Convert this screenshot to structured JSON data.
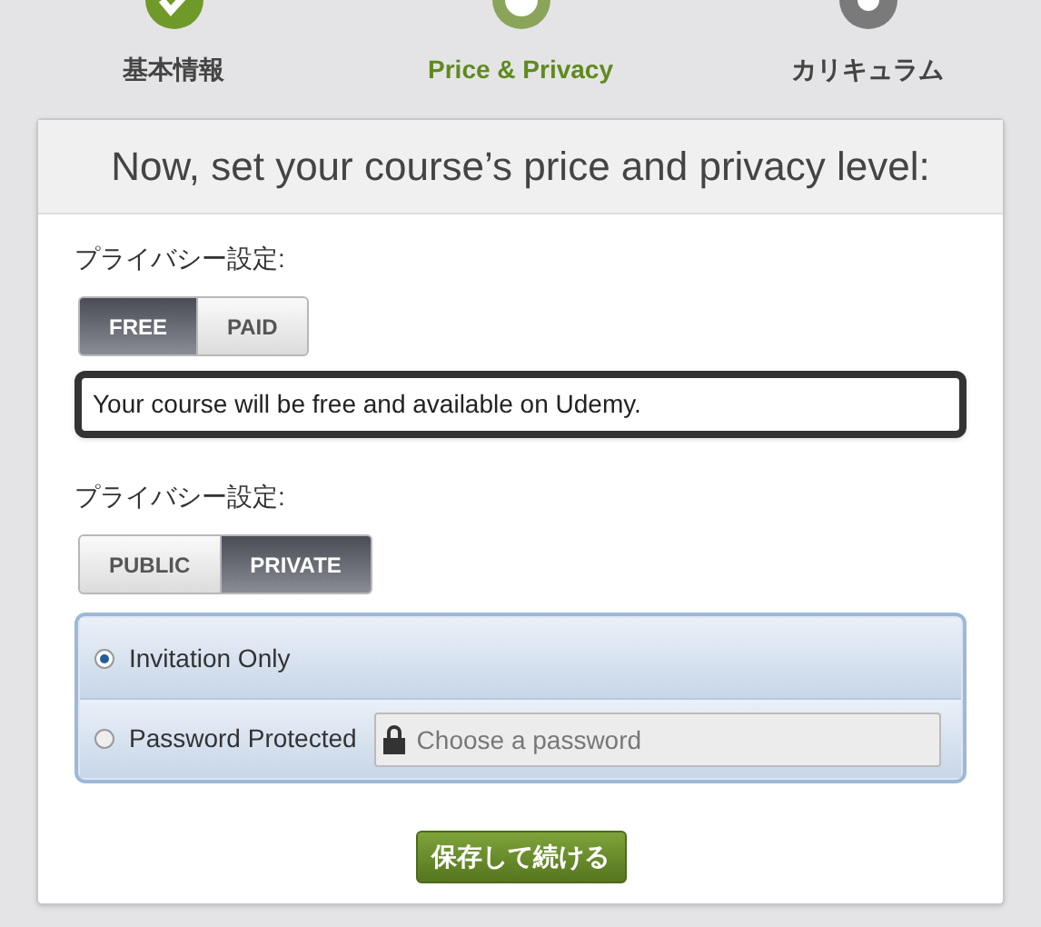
{
  "steps": [
    {
      "label": "基本情報",
      "done": true,
      "selected": false
    },
    {
      "label": "Price & Privacy",
      "done": false,
      "selected": true
    },
    {
      "label": "カリキュラム",
      "done": false,
      "selected": false
    }
  ],
  "title": "Now, set your course’s price and privacy level:",
  "price": {
    "label": "プライバシー設定:",
    "options": [
      {
        "label": "FREE",
        "selected": true
      },
      {
        "label": "PAID",
        "selected": false
      }
    ],
    "message": "Your course will be free and available on Udemy."
  },
  "privacy": {
    "label": "プライバシー設定:",
    "options": [
      {
        "label": "PUBLIC",
        "selected": false
      },
      {
        "label": "PRIVATE",
        "selected": true
      }
    ],
    "choices": [
      {
        "label": "Invitation Only",
        "selected": true,
        "kind": "plain"
      },
      {
        "label": "Password Protected",
        "selected": false,
        "kind": "password",
        "placeholder": "Choose a password"
      }
    ]
  },
  "save_button": "保存して続ける"
}
